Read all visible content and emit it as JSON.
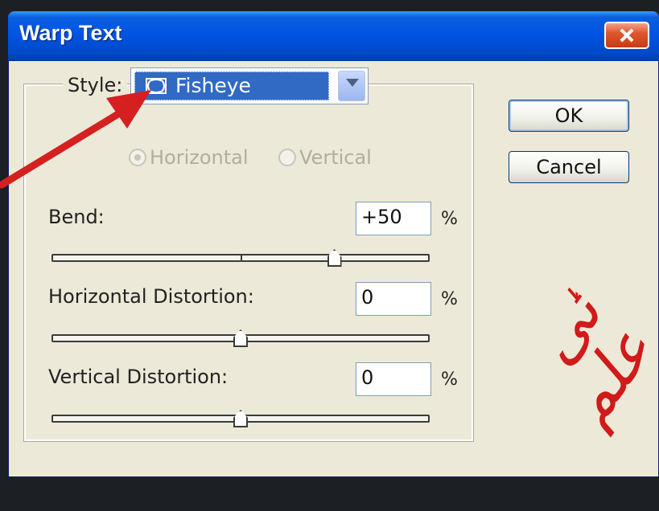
{
  "window": {
    "title": "Warp Text"
  },
  "style": {
    "label": "Style:",
    "selected": "Fisheye",
    "icon": "fisheye-warp-icon"
  },
  "orientation": {
    "options": [
      {
        "label": "Horizontal",
        "checked": true,
        "enabled": false
      },
      {
        "label": "Vertical",
        "checked": false,
        "enabled": false
      }
    ]
  },
  "sliders": [
    {
      "label": "Bend:",
      "value": "+50",
      "unit": "%",
      "position": 0.75,
      "center_tick": true
    },
    {
      "label": "Horizontal Distortion:",
      "value": "0",
      "unit": "%",
      "position": 0.5,
      "center_tick": false
    },
    {
      "label": "Vertical Distortion:",
      "value": "0",
      "unit": "%",
      "position": 0.5,
      "center_tick": false
    }
  ],
  "buttons": {
    "ok": "OK",
    "cancel": "Cancel"
  },
  "annotation": {
    "text": "ٹی علم",
    "color": "#d11a1a"
  },
  "colors": {
    "titlebar": "#0054e3",
    "selection": "#316ac5",
    "dialog_bg": "#ece9d8",
    "arrow": "#d62020"
  }
}
